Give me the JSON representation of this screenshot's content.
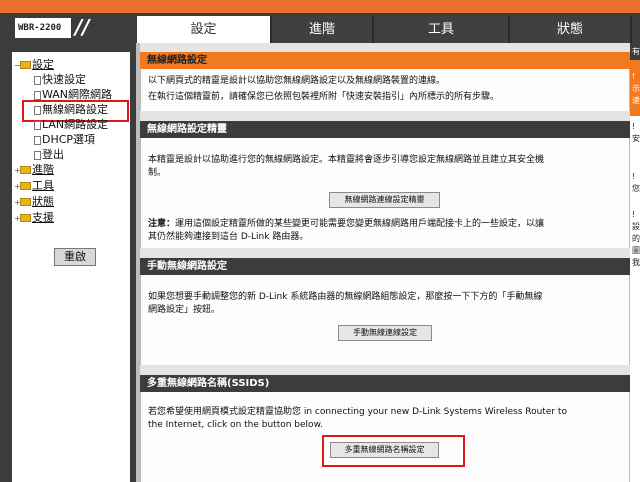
{
  "model": "WBR-2200",
  "tabs": [
    {
      "label": "設定",
      "active": true
    },
    {
      "label": "進階"
    },
    {
      "label": "工具"
    },
    {
      "label": "狀態"
    }
  ],
  "nav": {
    "root": "設定",
    "items": [
      "快速設定",
      "WAN網際網路",
      "無線網路設定",
      "LAN網路設定",
      "DHCP選項",
      "登出"
    ],
    "folders": [
      "進階",
      "工具",
      "狀態",
      "支援"
    ],
    "reboot": "重啟"
  },
  "sections": {
    "wireless_setup": {
      "title": "無線網路設定",
      "line1": "以下網頁式的精靈是設計以協助您無線網路設定以及無線網路裝置的連線。",
      "line2": "在執行這個精靈前，請確保您已依照包裝裡所附「快速安裝指引」內所標示的所有步驟。"
    },
    "wizard": {
      "title": "無線網路設定精靈",
      "line1": "本精靈是設計以協助進行您的無線網路設定。本精靈將會逐步引導您設定無線網路並且建立其安全機",
      "line2": "制。",
      "button": "無線網路連線設定精靈",
      "note_label": "注意：",
      "note1": "運用這個設定精靈所做的某些變更可能需要您變更無線網路用戶端配接卡上的一些設定，以讓",
      "note2": "其仍然能夠連接到這台 D-Link 路由器。"
    },
    "manual": {
      "title": "手動無線網路設定",
      "line1": "如果您想要手動調整您的新 D-Link 系統路由器的無線網路組態設定，那麼按一下下方的「手動無線",
      "line2": "網路設定」按鈕。",
      "button": "手動無線連線設定"
    },
    "ssid": {
      "title": "多重無線網路名稱(SSIDS)",
      "line1": "若您希望使用網頁模式設定精靈協助您 in connecting your new D-Link Systems Wireless Router to",
      "line2": "the Internet, click on the button below.",
      "button": "多重無線網路名稱設定"
    }
  },
  "right_chars": [
    "有",
    "!",
    "示",
    "速",
    "!",
    "安",
    "!",
    "您",
    "!",
    "設",
    "的",
    "圖",
    "我"
  ],
  "colors": {
    "accent": "#f17a20",
    "header": "#3c3c3c",
    "highlight": "#e0161b"
  }
}
